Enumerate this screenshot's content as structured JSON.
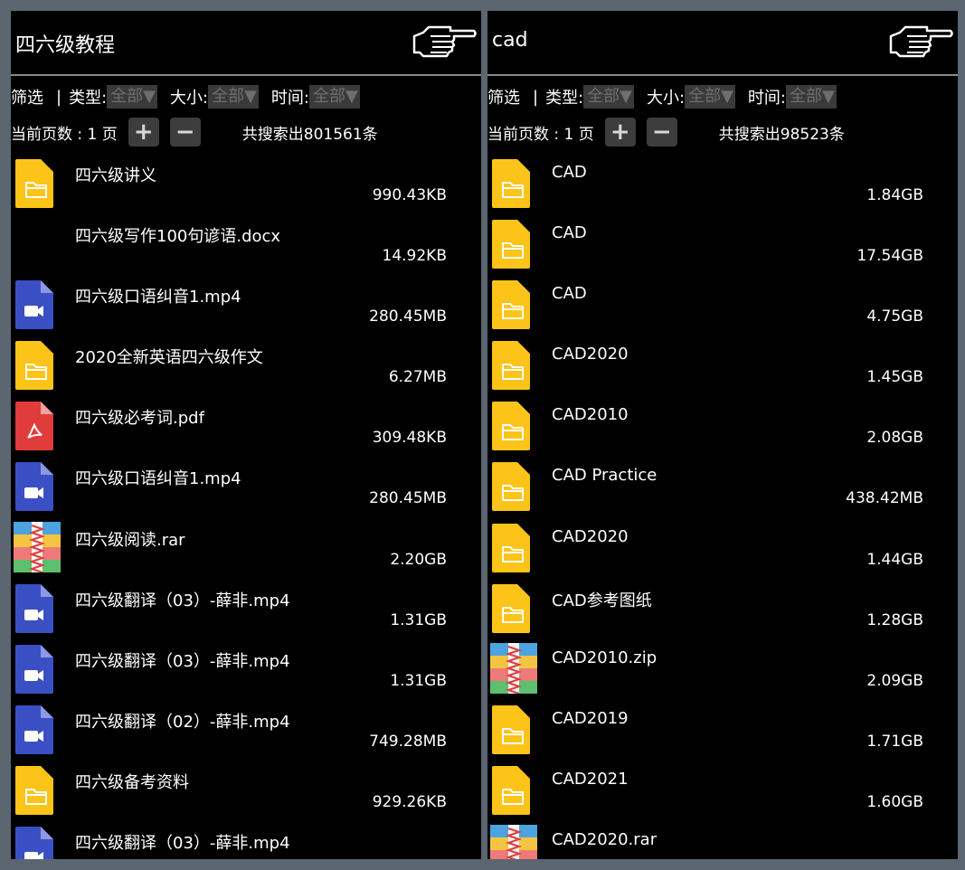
{
  "left": {
    "title": "四六级教程",
    "filters": {
      "filter_label": "筛选",
      "type_label": "类型:",
      "type_value": "全部▼",
      "size_label": "大小:",
      "size_value": "全部▼",
      "time_label": "时间:",
      "time_value": "全部▼"
    },
    "pager": {
      "page_text": "当前页数 : 1 页",
      "plus": "+",
      "minus": "−",
      "count_text": "共搜索出801561条"
    },
    "items": [
      {
        "name": "四六级讲义",
        "size": "990.43KB",
        "type": "folder"
      },
      {
        "name": "四六级写作100句谚语.docx",
        "size": "14.92KB",
        "type": "none"
      },
      {
        "name": "四六级口语纠音1.mp4",
        "size": "280.45MB",
        "type": "video"
      },
      {
        "name": "2020全新英语四六级作文",
        "size": "6.27MB",
        "type": "folder"
      },
      {
        "name": "四六级必考词.pdf",
        "size": "309.48KB",
        "type": "pdf"
      },
      {
        "name": "四六级口语纠音1.mp4",
        "size": "280.45MB",
        "type": "video"
      },
      {
        "name": "四六级阅读.rar",
        "size": "2.20GB",
        "type": "archive"
      },
      {
        "name": "四六级翻译（03）-薛非.mp4",
        "size": "1.31GB",
        "type": "video"
      },
      {
        "name": "四六级翻译（03）-薛非.mp4",
        "size": "1.31GB",
        "type": "video"
      },
      {
        "name": "四六级翻译（02）-薛非.mp4",
        "size": "749.28MB",
        "type": "video"
      },
      {
        "name": "四六级备考资料",
        "size": "929.26KB",
        "type": "folder"
      },
      {
        "name": "四六级翻译（03）-薛非.mp4",
        "size": "",
        "type": "video"
      }
    ]
  },
  "right": {
    "title": "cad",
    "filters": {
      "filter_label": "筛选",
      "type_label": "类型:",
      "type_value": "全部▼",
      "size_label": "大小:",
      "size_value": "全部▼",
      "time_label": "时间:",
      "time_value": "全部▼"
    },
    "pager": {
      "page_text": "当前页数 : 1 页",
      "plus": "+",
      "minus": "−",
      "count_text": "共搜索出98523条"
    },
    "items": [
      {
        "name": "CAD",
        "size": "1.84GB",
        "type": "folder"
      },
      {
        "name": "CAD",
        "size": "17.54GB",
        "type": "folder"
      },
      {
        "name": "CAD",
        "size": "4.75GB",
        "type": "folder"
      },
      {
        "name": "CAD2020",
        "size": "1.45GB",
        "type": "folder"
      },
      {
        "name": "CAD2010",
        "size": "2.08GB",
        "type": "folder"
      },
      {
        "name": "CAD Practice",
        "size": "438.42MB",
        "type": "folder"
      },
      {
        "name": "CAD2020",
        "size": "1.44GB",
        "type": "folder"
      },
      {
        "name": "CAD参考图纸",
        "size": "1.28GB",
        "type": "folder"
      },
      {
        "name": "CAD2010.zip",
        "size": "2.09GB",
        "type": "archive"
      },
      {
        "name": "CAD2019",
        "size": "1.71GB",
        "type": "folder"
      },
      {
        "name": "CAD2021",
        "size": "1.60GB",
        "type": "folder"
      },
      {
        "name": "CAD2020.rar",
        "size": "",
        "type": "archive"
      }
    ]
  },
  "colors": {
    "folder": "#fcc419",
    "video": "#3b4fc4",
    "pdf": "#e03c3c",
    "background": "#000000",
    "frame": "#5c6670"
  }
}
